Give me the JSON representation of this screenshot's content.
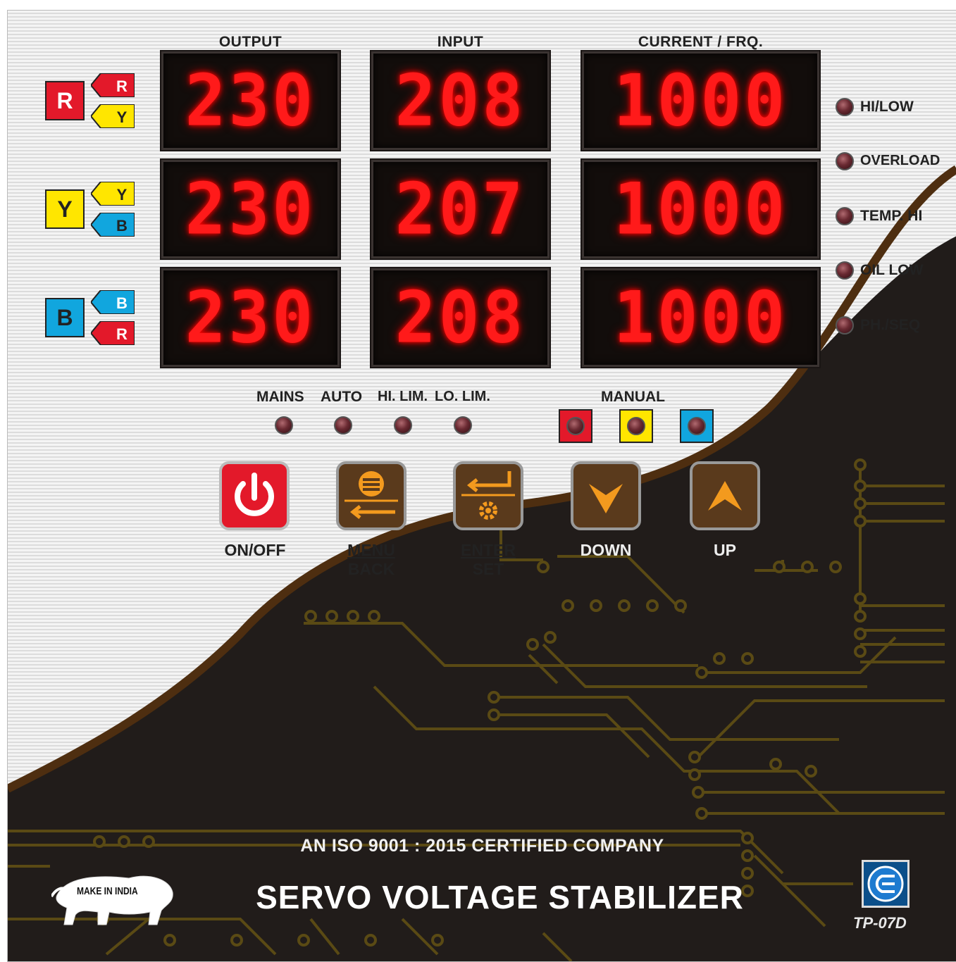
{
  "headers": {
    "output": "OUTPUT",
    "input": "INPUT",
    "current": "CURRENT / FRQ."
  },
  "phases": [
    {
      "name": "R",
      "color": "#e3192a",
      "tag_top": "R",
      "tag_top_color": "#e3192a",
      "tag_bottom": "Y",
      "tag_bottom_color": "#ffe600",
      "output": "230",
      "input": "208",
      "current": "1000"
    },
    {
      "name": "Y",
      "color": "#ffe600",
      "tag_top": "Y",
      "tag_top_color": "#ffe600",
      "tag_bottom": "B",
      "tag_bottom_color": "#11a6de",
      "output": "230",
      "input": "207",
      "current": "1000"
    },
    {
      "name": "B",
      "color": "#11a6de",
      "tag_top": "B",
      "tag_top_color": "#11a6de",
      "tag_bottom": "R",
      "tag_bottom_color": "#e3192a",
      "output": "230",
      "input": "208",
      "current": "1000"
    }
  ],
  "status_leds": [
    "HI/LOW",
    "OVERLOAD",
    "TEMP. HI",
    "OIL LOW",
    "PH./SEQ"
  ],
  "mode_leds": [
    "MAINS",
    "AUTO",
    "HI. LIM.",
    "LO. LIM."
  ],
  "manual": {
    "label": "MANUAL",
    "colors": [
      "#e3192a",
      "#ffe600",
      "#11a6de"
    ]
  },
  "buttons": {
    "onoff": "ON/OFF",
    "menu": "MENU",
    "back": "BACK",
    "enter": "ENTER",
    "set": "SET",
    "down": "DOWN",
    "up": "UP"
  },
  "footer": {
    "iso": "AN ISO 9001 : 2015 CERTIFIED COMPANY",
    "title": "SERVO VOLTAGE STABILIZER",
    "model": "TP-07D",
    "make_in_india": "MAKE IN INDIA"
  },
  "colors": {
    "led_display": "#ff1a1a",
    "button_brown": "#5a3a1c",
    "button_red": "#e3192a",
    "icon_orange": "#f39a1e",
    "pcb_dark": "#211c1a",
    "trace": "#5a4a14",
    "wave_brown": "#4e2e10"
  }
}
